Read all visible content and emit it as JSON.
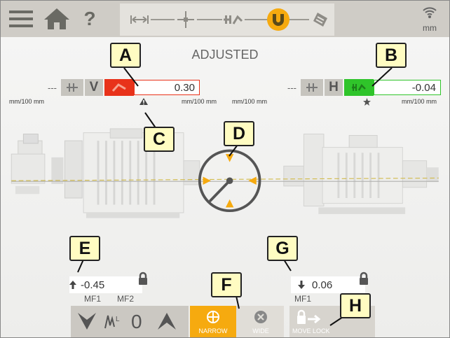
{
  "topbar": {
    "help_label": "?",
    "unit_label": "mm"
  },
  "main": {
    "title": "ADJUSTED"
  },
  "vertical": {
    "dash": "---",
    "letter": "V",
    "value": "0.30",
    "unit_left": "mm/100 mm",
    "unit_right": "mm/100 mm",
    "status_color": "#e8321a"
  },
  "horizontal": {
    "dash": "---",
    "letter": "H",
    "value": "-0.04",
    "unit_left": "mm/100 mm",
    "unit_right": "mm/100 mm",
    "status_color": "#2fc42a"
  },
  "moves": {
    "vertical_value": "-0.45",
    "horizontal_value": "0.06",
    "mf1_left": "MF1",
    "mf2_left": "MF2",
    "mf1_right": "MF1"
  },
  "bottom": {
    "zero_label": "0",
    "narrow_label": "NARROW",
    "wide_label": "WIDE",
    "move_lock_label": "MOVE LOCK"
  },
  "callouts": [
    "A",
    "B",
    "C",
    "D",
    "E",
    "F",
    "G",
    "H"
  ],
  "colors": {
    "accent": "#f6aa0f",
    "toolbar": "#cfccc6"
  }
}
